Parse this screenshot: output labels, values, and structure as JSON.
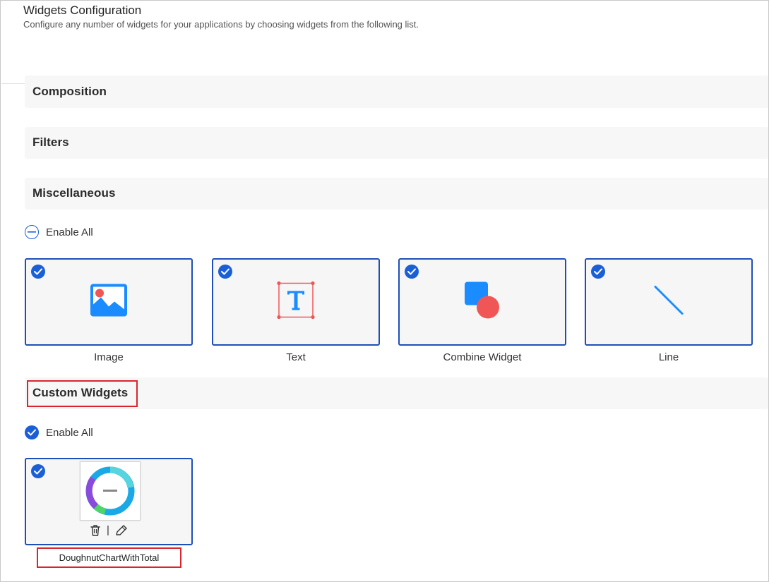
{
  "header": {
    "title": "Widgets Configuration",
    "subtitle": "Configure any number of widgets for your applications by choosing widgets from the following list."
  },
  "sections": {
    "composition": "Composition",
    "filters": "Filters",
    "miscellaneous": "Miscellaneous",
    "custom": "Custom Widgets"
  },
  "miscellaneous": {
    "enable_all_label": "Enable All",
    "enable_all_state": "partial",
    "widgets": [
      {
        "label": "Image",
        "icon": "image-icon",
        "checked": true
      },
      {
        "label": "Text",
        "icon": "text-icon",
        "checked": true
      },
      {
        "label": "Combine Widget",
        "icon": "combine-widget-icon",
        "checked": true
      },
      {
        "label": "Line",
        "icon": "line-icon",
        "checked": true
      }
    ]
  },
  "custom": {
    "enable_all_label": "Enable All",
    "enable_all_state": "checked",
    "widgets": [
      {
        "label": "DoughnutChartWithTotal",
        "checked": true,
        "separator": "|"
      }
    ]
  },
  "colors": {
    "accent": "#1b5fd6",
    "card_border": "#1e4fb8",
    "highlight": "#d9262e",
    "image_icon": "#1a8cff",
    "coral": "#f05656"
  }
}
